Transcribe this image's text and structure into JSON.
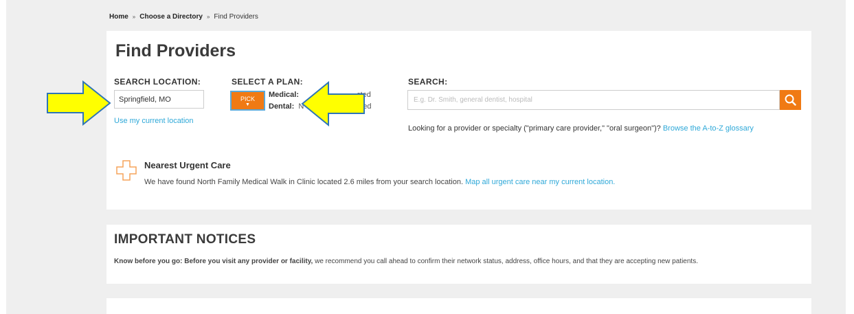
{
  "breadcrumb": {
    "home": "Home",
    "directory": "Choose a Directory",
    "current": "Find Providers",
    "separator": "»"
  },
  "page_title": "Find Providers",
  "search_location": {
    "label": "SEARCH LOCATION:",
    "value": "Springfield, MO",
    "use_current": "Use my current location"
  },
  "plan": {
    "label": "SELECT A PLAN:",
    "pick_label": "PICK",
    "medical_label": "Medical:",
    "medical_value": "cted",
    "dental_label": "Dental:",
    "dental_value": "N",
    "dental_value_tail": "ed"
  },
  "search": {
    "label": "SEARCH:",
    "placeholder": "E.g. Dr. Smith, general dentist, hospital",
    "help_text": "Looking for a provider or specialty (\"primary care provider,\" \"oral surgeon\")?",
    "help_link": "Browse the A-to-Z glossary"
  },
  "urgent_care": {
    "title": "Nearest Urgent Care",
    "text": "We have found North Family Medical Walk in Clinic located 2.6 miles from your search location.",
    "link": "Map all urgent care near my current location."
  },
  "notices": {
    "title": "IMPORTANT NOTICES",
    "bold_text": "Know before you go: Before you visit any provider or facility,",
    "text": "we recommend you call ahead to confirm their network status, address, office hours, and that they are accepting new patients."
  },
  "icons": {
    "search_button": "search-icon",
    "urgent_care": "plus-outline-icon",
    "annotation": "arrow-icon"
  },
  "colors": {
    "accent_orange": "#f07a14",
    "link_blue": "#2ea8d8",
    "arrow_fill": "#ffff00",
    "arrow_stroke": "#2e75b6"
  }
}
